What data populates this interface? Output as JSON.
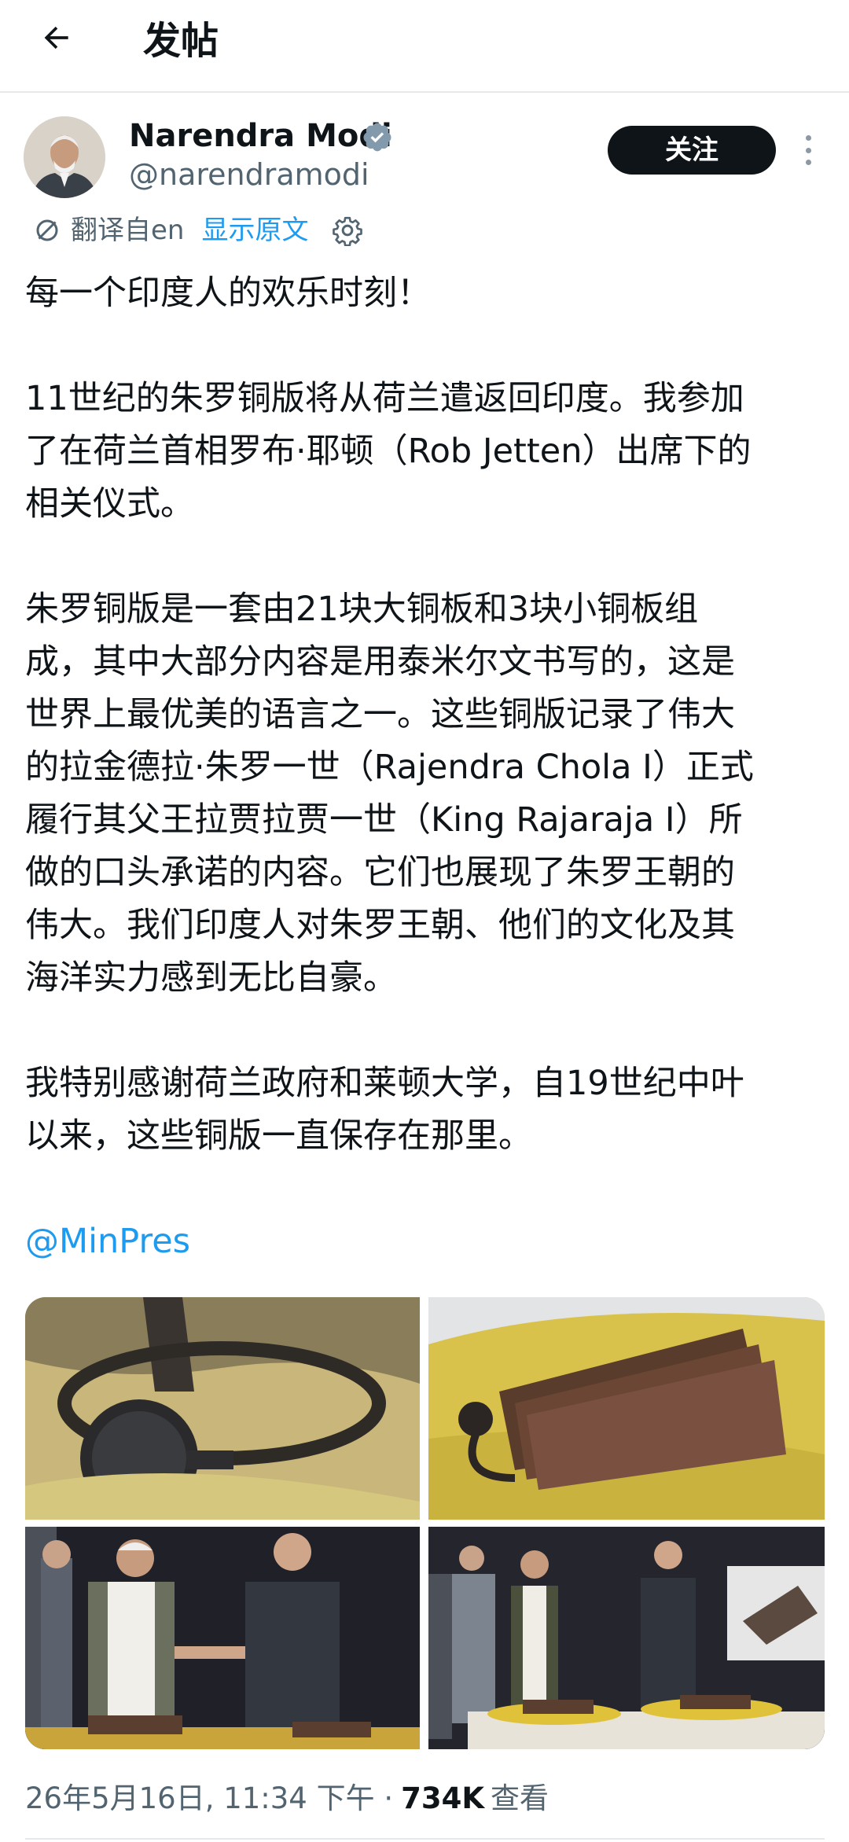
{
  "header": {
    "title": "发帖",
    "back_icon": "arrow-left-icon"
  },
  "author": {
    "name": "Narendra Modi",
    "handle": "@narendramodi",
    "verified_icon": "verified-badge-icon",
    "follow_label": "关注",
    "more_icon": "more-vertical-icon"
  },
  "translation": {
    "label": "翻译自en",
    "show_original": "显示原文",
    "settings_icon": "gear-icon",
    "translate_icon": "translate-icon"
  },
  "tweet": {
    "paragraphs": [
      "每一个印度人的欢乐时刻！",
      "11世纪的朱罗铜版将从荷兰遣返回印度。我参加\n了在荷兰首相罗布·耶顿（Rob Jetten）出席下的\n相关仪式。",
      "朱罗铜版是一套由21块大铜板和3块小铜板组\n成，其中大部分内容是用泰米尔文书写的，这是\n世界上最优美的语言之一。这些铜版记录了伟大\n的拉金德拉·朱罗一世（Rajendra Chola I）正式\n履行其父王拉贾拉贾一世（King Rajaraja I）所\n做的口头承诺的内容。它们也展现了朱罗王朝的\n伟大。我们印度人对朱罗王朝、他们的文化及其\n海洋实力感到无比自豪。",
      "我特别感谢荷兰政府和莱顿大学，自19世纪中叶\n以来，这些铜版一直保存在那里。"
    ],
    "mention": "@MinPres"
  },
  "media": [
    {
      "kind": "photo",
      "subject": "copper plate ring seal"
    },
    {
      "kind": "photo",
      "subject": "copper plates on yellow cushion"
    },
    {
      "kind": "photo",
      "subject": "handshake at ceremony"
    },
    {
      "kind": "photo",
      "subject": "group at ceremony with plates"
    }
  ],
  "meta": {
    "timestamp": "26年5月16日, 11:34 下午 · ",
    "views": "734K",
    "views_label": "查看"
  },
  "colors": {
    "link": "#1d9bf0",
    "text": "#0f1419",
    "secondary": "#536471"
  }
}
